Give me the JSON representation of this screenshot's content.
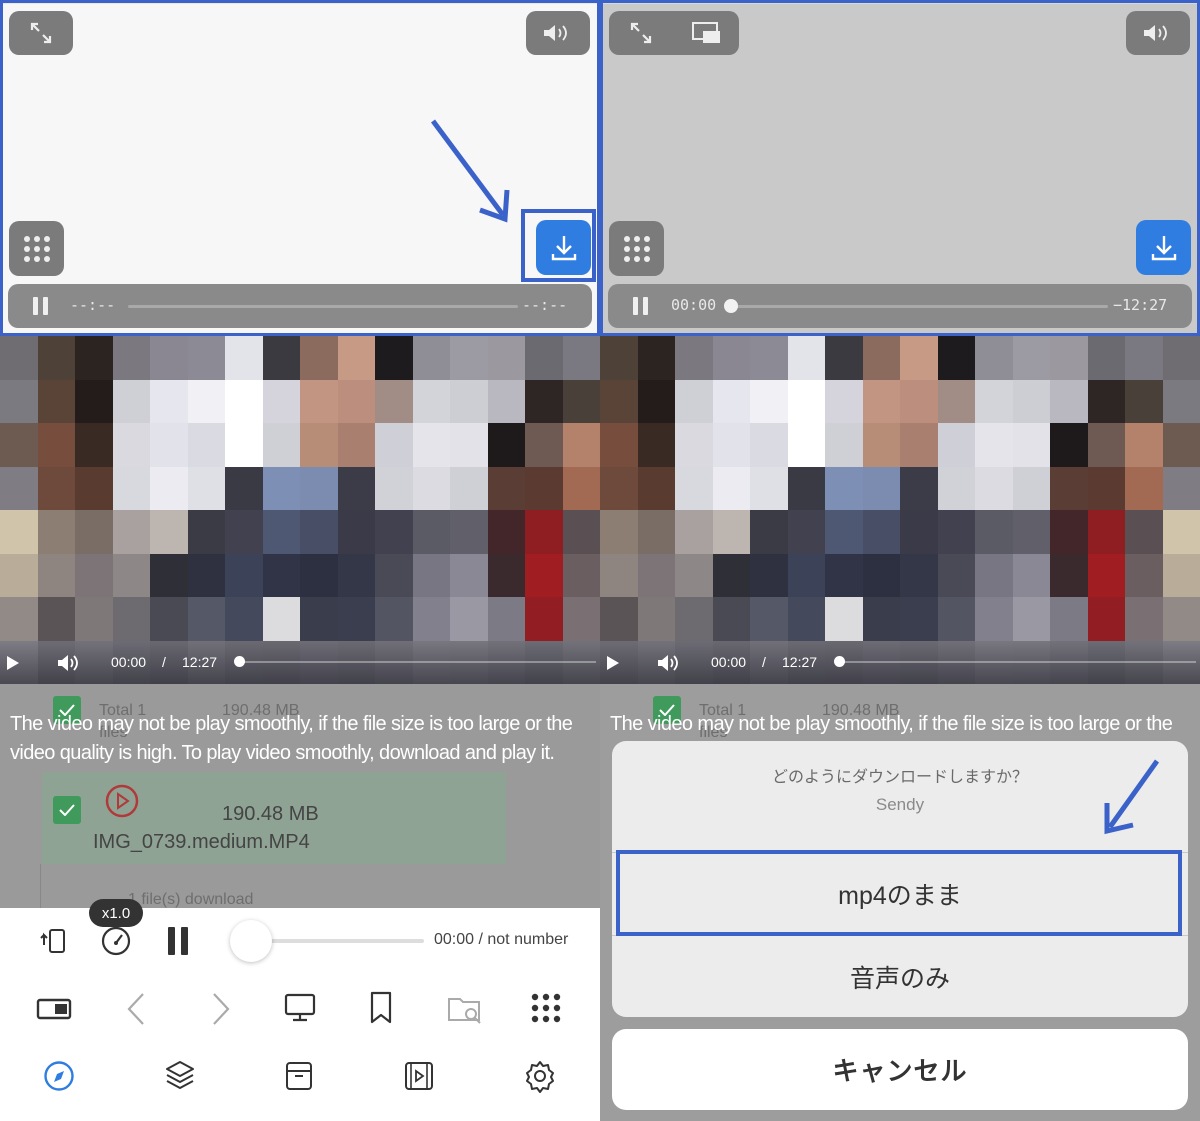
{
  "left": {
    "seek": {
      "current": "--:--",
      "remaining": "--:--"
    },
    "video_controls": {
      "current": "00:00",
      "sep": "/",
      "duration": "12:27"
    },
    "bg_rows": {
      "total_label": "Total 1",
      "size1": "190.48 MB",
      "files_label": "files",
      "size2": "190.48 MB",
      "filename": "IMG_0739.medium.MP4",
      "download_label": "1 file(s) download"
    },
    "notice": "The video may not be play smoothly, if the file size is too large or the video quality is high. To play video smoothly, download and play it.",
    "player_bar": {
      "speed": "x1.0",
      "time": "00:00 / not number"
    },
    "toolbar_icons": [
      "rotate-icon",
      "speedometer-icon",
      "pause-icon",
      "window-icon",
      "back-icon",
      "forward-icon",
      "desktop-icon",
      "bookmark-icon",
      "folder-search-icon",
      "grid-menu-icon",
      "compass-icon",
      "layers-icon",
      "archive-icon",
      "video-icon",
      "settings-icon"
    ]
  },
  "right": {
    "seek": {
      "current": "00:00",
      "remaining": "−12:27"
    },
    "video_controls": {
      "current": "00:00",
      "sep": "/",
      "duration": "12:27"
    },
    "bg_rows": {
      "total_label": "Total 1",
      "size1": "190.48 MB",
      "files_label": "files"
    },
    "notice": "The video may not be play smoothly, if the file size is too large or the",
    "sheet": {
      "title": "どのようにダウンロードしますか？",
      "subtitle": "Sendy",
      "options": [
        "mp4のまま",
        "音声のみ"
      ],
      "cancel": "キャンセル"
    }
  },
  "colors": {
    "accent": "#2f7de0",
    "annotation": "#3b62c9",
    "check": "#3f9a5c"
  }
}
